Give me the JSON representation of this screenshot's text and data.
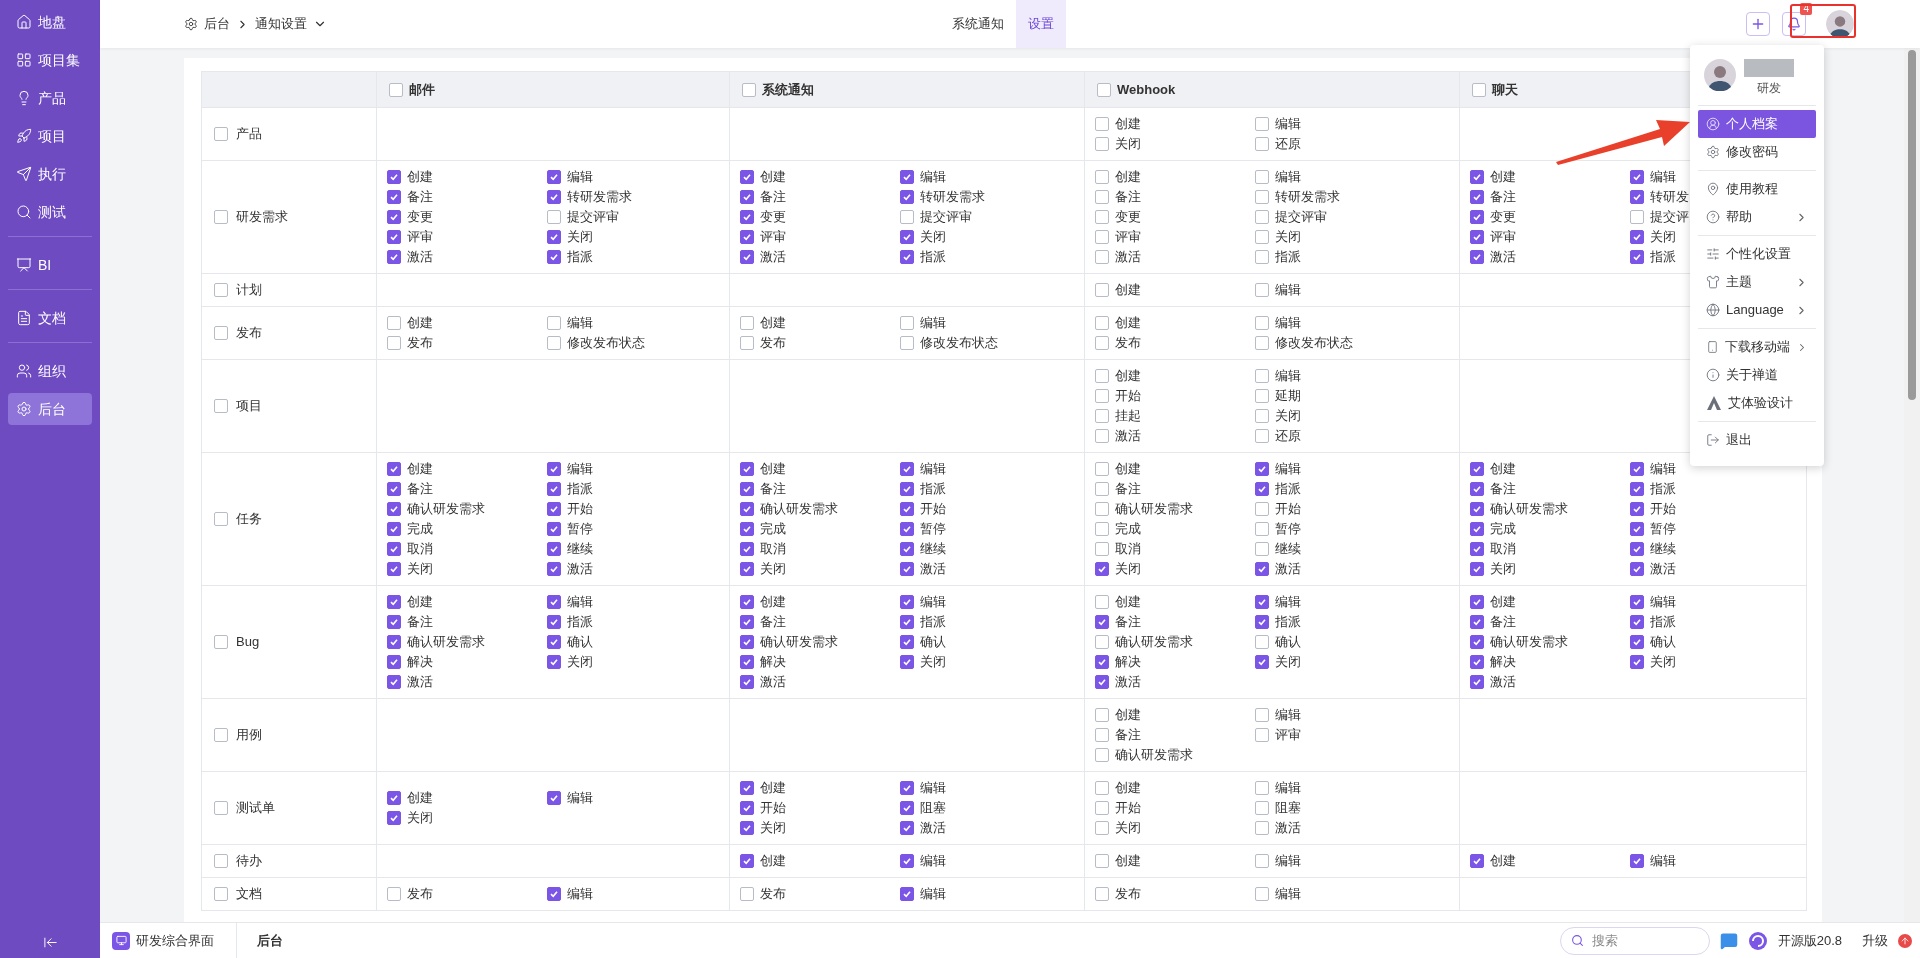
{
  "sidebar": {
    "groups": [
      [
        {
          "label": "地盘",
          "selected": false
        },
        {
          "label": "项目集",
          "selected": false
        },
        {
          "label": "产品",
          "selected": false
        },
        {
          "label": "项目",
          "selected": false
        },
        {
          "label": "执行",
          "selected": false
        },
        {
          "label": "测试",
          "selected": false
        }
      ],
      [
        {
          "label": "BI",
          "selected": false
        }
      ],
      [
        {
          "label": "文档",
          "selected": false
        }
      ],
      [
        {
          "label": "组织",
          "selected": false
        },
        {
          "label": "后台",
          "selected": true
        }
      ]
    ]
  },
  "breadcrumb": [
    "后台",
    "通知设置"
  ],
  "tabs": [
    {
      "label": "系统通知",
      "selected": false
    },
    {
      "label": "设置",
      "selected": true
    }
  ],
  "notifications_badge": "4",
  "table": {
    "columns": [
      {
        "label": "邮件",
        "checked": false
      },
      {
        "label": "系统通知",
        "checked": false
      },
      {
        "label": "Webhook",
        "checked": false
      },
      {
        "label": "聊天",
        "checked": false
      }
    ],
    "rows": [
      {
        "label": "产品",
        "checked": false,
        "cells": [
          null,
          null,
          [
            {
              "label": "创建",
              "checked": false
            },
            {
              "label": "编辑",
              "checked": false
            },
            {
              "label": "关闭",
              "checked": false
            },
            {
              "label": "还原",
              "checked": false
            }
          ],
          null
        ]
      },
      {
        "label": "研发需求",
        "checked": false,
        "cells": [
          [
            {
              "label": "创建",
              "checked": true
            },
            {
              "label": "编辑",
              "checked": true
            },
            {
              "label": "备注",
              "checked": true
            },
            {
              "label": "转研发需求",
              "checked": true
            },
            {
              "label": "变更",
              "checked": true
            },
            {
              "label": "提交评审",
              "checked": false
            },
            {
              "label": "评审",
              "checked": true
            },
            {
              "label": "关闭",
              "checked": true
            },
            {
              "label": "激活",
              "checked": true
            },
            {
              "label": "指派",
              "checked": true
            }
          ],
          [
            {
              "label": "创建",
              "checked": true
            },
            {
              "label": "编辑",
              "checked": true
            },
            {
              "label": "备注",
              "checked": true
            },
            {
              "label": "转研发需求",
              "checked": true
            },
            {
              "label": "变更",
              "checked": true
            },
            {
              "label": "提交评审",
              "checked": false
            },
            {
              "label": "评审",
              "checked": true
            },
            {
              "label": "关闭",
              "checked": true
            },
            {
              "label": "激活",
              "checked": true
            },
            {
              "label": "指派",
              "checked": true
            }
          ],
          [
            {
              "label": "创建",
              "checked": false
            },
            {
              "label": "编辑",
              "checked": false
            },
            {
              "label": "备注",
              "checked": false
            },
            {
              "label": "转研发需求",
              "checked": false
            },
            {
              "label": "变更",
              "checked": false
            },
            {
              "label": "提交评审",
              "checked": false
            },
            {
              "label": "评审",
              "checked": false
            },
            {
              "label": "关闭",
              "checked": false
            },
            {
              "label": "激活",
              "checked": false
            },
            {
              "label": "指派",
              "checked": false
            }
          ],
          [
            {
              "label": "创建",
              "checked": true
            },
            {
              "label": "编辑",
              "checked": true
            },
            {
              "label": "备注",
              "checked": true
            },
            {
              "label": "转研发",
              "checked": true
            },
            {
              "label": "变更",
              "checked": true
            },
            {
              "label": "提交评",
              "checked": false
            },
            {
              "label": "评审",
              "checked": true
            },
            {
              "label": "关闭",
              "checked": true
            },
            {
              "label": "激活",
              "checked": true
            },
            {
              "label": "指派",
              "checked": true
            }
          ]
        ]
      },
      {
        "label": "计划",
        "checked": false,
        "cells": [
          null,
          null,
          [
            {
              "label": "创建",
              "checked": false
            },
            {
              "label": "编辑",
              "checked": false
            }
          ],
          null
        ]
      },
      {
        "label": "发布",
        "checked": false,
        "cells": [
          [
            {
              "label": "创建",
              "checked": false
            },
            {
              "label": "编辑",
              "checked": false
            },
            {
              "label": "发布",
              "checked": false
            },
            {
              "label": "修改发布状态",
              "checked": false
            }
          ],
          [
            {
              "label": "创建",
              "checked": false
            },
            {
              "label": "编辑",
              "checked": false
            },
            {
              "label": "发布",
              "checked": false
            },
            {
              "label": "修改发布状态",
              "checked": false
            }
          ],
          [
            {
              "label": "创建",
              "checked": false
            },
            {
              "label": "编辑",
              "checked": false
            },
            {
              "label": "发布",
              "checked": false
            },
            {
              "label": "修改发布状态",
              "checked": false
            }
          ],
          null
        ]
      },
      {
        "label": "项目",
        "checked": false,
        "cells": [
          null,
          null,
          [
            {
              "label": "创建",
              "checked": false
            },
            {
              "label": "编辑",
              "checked": false
            },
            {
              "label": "开始",
              "checked": false
            },
            {
              "label": "延期",
              "checked": false
            },
            {
              "label": "挂起",
              "checked": false
            },
            {
              "label": "关闭",
              "checked": false
            },
            {
              "label": "激活",
              "checked": false
            },
            {
              "label": "还原",
              "checked": false
            }
          ],
          null
        ]
      },
      {
        "label": "任务",
        "checked": false,
        "cells": [
          [
            {
              "label": "创建",
              "checked": true
            },
            {
              "label": "编辑",
              "checked": true
            },
            {
              "label": "备注",
              "checked": true
            },
            {
              "label": "指派",
              "checked": true
            },
            {
              "label": "确认研发需求",
              "checked": true
            },
            {
              "label": "开始",
              "checked": true
            },
            {
              "label": "完成",
              "checked": true
            },
            {
              "label": "暂停",
              "checked": true
            },
            {
              "label": "取消",
              "checked": true
            },
            {
              "label": "继续",
              "checked": true
            },
            {
              "label": "关闭",
              "checked": true
            },
            {
              "label": "激活",
              "checked": true
            }
          ],
          [
            {
              "label": "创建",
              "checked": true
            },
            {
              "label": "编辑",
              "checked": true
            },
            {
              "label": "备注",
              "checked": true
            },
            {
              "label": "指派",
              "checked": true
            },
            {
              "label": "确认研发需求",
              "checked": true
            },
            {
              "label": "开始",
              "checked": true
            },
            {
              "label": "完成",
              "checked": true
            },
            {
              "label": "暂停",
              "checked": true
            },
            {
              "label": "取消",
              "checked": true
            },
            {
              "label": "继续",
              "checked": true
            },
            {
              "label": "关闭",
              "checked": true
            },
            {
              "label": "激活",
              "checked": true
            }
          ],
          [
            {
              "label": "创建",
              "checked": false
            },
            {
              "label": "编辑",
              "checked": true
            },
            {
              "label": "备注",
              "checked": false
            },
            {
              "label": "指派",
              "checked": true
            },
            {
              "label": "确认研发需求",
              "checked": false
            },
            {
              "label": "开始",
              "checked": false
            },
            {
              "label": "完成",
              "checked": false
            },
            {
              "label": "暂停",
              "checked": false
            },
            {
              "label": "取消",
              "checked": false
            },
            {
              "label": "继续",
              "checked": false
            },
            {
              "label": "关闭",
              "checked": true
            },
            {
              "label": "激活",
              "checked": true
            }
          ],
          [
            {
              "label": "创建",
              "checked": true
            },
            {
              "label": "编辑",
              "checked": true
            },
            {
              "label": "备注",
              "checked": true
            },
            {
              "label": "指派",
              "checked": true
            },
            {
              "label": "确认研发需求",
              "checked": true
            },
            {
              "label": "开始",
              "checked": true
            },
            {
              "label": "完成",
              "checked": true
            },
            {
              "label": "暂停",
              "checked": true
            },
            {
              "label": "取消",
              "checked": true
            },
            {
              "label": "继续",
              "checked": true
            },
            {
              "label": "关闭",
              "checked": true
            },
            {
              "label": "激活",
              "checked": true
            }
          ]
        ]
      },
      {
        "label": "Bug",
        "checked": false,
        "cells": [
          [
            {
              "label": "创建",
              "checked": true
            },
            {
              "label": "编辑",
              "checked": true
            },
            {
              "label": "备注",
              "checked": true
            },
            {
              "label": "指派",
              "checked": true
            },
            {
              "label": "确认研发需求",
              "checked": true
            },
            {
              "label": "确认",
              "checked": true
            },
            {
              "label": "解决",
              "checked": true
            },
            {
              "label": "关闭",
              "checked": true
            },
            {
              "label": "激活",
              "checked": true
            }
          ],
          [
            {
              "label": "创建",
              "checked": true
            },
            {
              "label": "编辑",
              "checked": true
            },
            {
              "label": "备注",
              "checked": true
            },
            {
              "label": "指派",
              "checked": true
            },
            {
              "label": "确认研发需求",
              "checked": true
            },
            {
              "label": "确认",
              "checked": true
            },
            {
              "label": "解决",
              "checked": true
            },
            {
              "label": "关闭",
              "checked": true
            },
            {
              "label": "激活",
              "checked": true
            }
          ],
          [
            {
              "label": "创建",
              "checked": false
            },
            {
              "label": "编辑",
              "checked": true
            },
            {
              "label": "备注",
              "checked": true
            },
            {
              "label": "指派",
              "checked": true
            },
            {
              "label": "确认研发需求",
              "checked": false
            },
            {
              "label": "确认",
              "checked": false
            },
            {
              "label": "解决",
              "checked": true
            },
            {
              "label": "关闭",
              "checked": true
            },
            {
              "label": "激活",
              "checked": true
            }
          ],
          [
            {
              "label": "创建",
              "checked": true
            },
            {
              "label": "编辑",
              "checked": true
            },
            {
              "label": "备注",
              "checked": true
            },
            {
              "label": "指派",
              "checked": true
            },
            {
              "label": "确认研发需求",
              "checked": true
            },
            {
              "label": "确认",
              "checked": true
            },
            {
              "label": "解决",
              "checked": true
            },
            {
              "label": "关闭",
              "checked": true
            },
            {
              "label": "激活",
              "checked": true
            }
          ]
        ]
      },
      {
        "label": "用例",
        "checked": false,
        "cells": [
          null,
          null,
          [
            {
              "label": "创建",
              "checked": false
            },
            {
              "label": "编辑",
              "checked": false
            },
            {
              "label": "备注",
              "checked": false
            },
            {
              "label": "评审",
              "checked": false
            },
            {
              "label": "确认研发需求",
              "checked": false
            }
          ],
          null
        ]
      },
      {
        "label": "测试单",
        "checked": false,
        "cells": [
          [
            {
              "label": "创建",
              "checked": true
            },
            {
              "label": "编辑",
              "checked": true
            },
            {
              "label": "关闭",
              "checked": true
            }
          ],
          [
            {
              "label": "创建",
              "checked": true
            },
            {
              "label": "编辑",
              "checked": true
            },
            {
              "label": "开始",
              "checked": true
            },
            {
              "label": "阻塞",
              "checked": true
            },
            {
              "label": "关闭",
              "checked": true
            },
            {
              "label": "激活",
              "checked": true
            }
          ],
          [
            {
              "label": "创建",
              "checked": false
            },
            {
              "label": "编辑",
              "checked": false
            },
            {
              "label": "开始",
              "checked": false
            },
            {
              "label": "阻塞",
              "checked": false
            },
            {
              "label": "关闭",
              "checked": false
            },
            {
              "label": "激活",
              "checked": false
            }
          ],
          null
        ]
      },
      {
        "label": "待办",
        "checked": false,
        "cells": [
          null,
          [
            {
              "label": "创建",
              "checked": true
            },
            {
              "label": "编辑",
              "checked": true
            }
          ],
          [
            {
              "label": "创建",
              "checked": false
            },
            {
              "label": "编辑",
              "checked": false
            }
          ],
          [
            {
              "label": "创建",
              "checked": true
            },
            {
              "label": "编辑",
              "checked": true
            }
          ]
        ]
      },
      {
        "label": "文档",
        "checked": false,
        "cells": [
          [
            {
              "label": "发布",
              "checked": false
            },
            {
              "label": "编辑",
              "checked": true
            }
          ],
          [
            {
              "label": "发布",
              "checked": false
            },
            {
              "label": "编辑",
              "checked": true
            }
          ],
          [
            {
              "label": "发布",
              "checked": false
            },
            {
              "label": "编辑",
              "checked": false
            }
          ],
          null
        ]
      }
    ]
  },
  "user_menu": {
    "role": "研发",
    "groups": [
      [
        {
          "label": "个人档案",
          "selected": true,
          "submenu": false
        },
        {
          "label": "修改密码",
          "selected": false,
          "submenu": false
        }
      ],
      [
        {
          "label": "使用教程",
          "selected": false,
          "submenu": false
        },
        {
          "label": "帮助",
          "selected": false,
          "submenu": true
        }
      ],
      [
        {
          "label": "个性化设置",
          "selected": false,
          "submenu": false
        },
        {
          "label": "主题",
          "selected": false,
          "submenu": true
        },
        {
          "label": "Language",
          "selected": false,
          "submenu": true
        }
      ],
      [
        {
          "label": "下载移动端",
          "selected": false,
          "submenu": true
        },
        {
          "label": "关于禅道",
          "selected": false,
          "submenu": false
        },
        {
          "label": "艾体验设计",
          "selected": false,
          "submenu": false
        }
      ],
      [
        {
          "label": "退出",
          "selected": false,
          "submenu": false
        }
      ]
    ]
  },
  "bottom_bar": {
    "app": "研发综合界面",
    "current": "后台",
    "search_placeholder": "搜索",
    "version": "开源版20.8",
    "upgrade": "升级"
  }
}
